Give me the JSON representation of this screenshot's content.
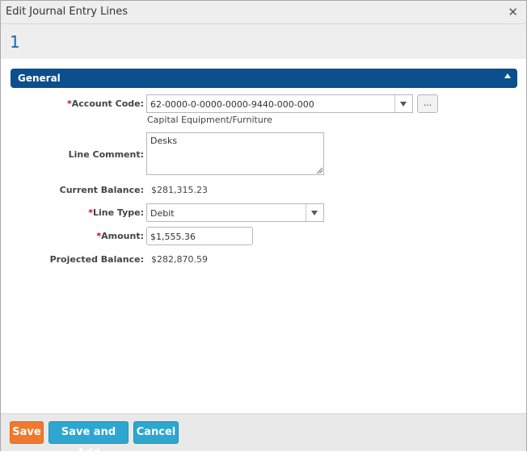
{
  "window": {
    "title": "Edit Journal Entry Lines"
  },
  "header": {
    "record_id": "1"
  },
  "section": {
    "title": "General"
  },
  "fields": {
    "required_mark": "*",
    "account_code": {
      "label": "Account Code:",
      "value": "62-0000-0-0000-0000-9440-000-000",
      "description": "Capital Equipment/Furniture",
      "lookup_label": "..."
    },
    "line_comment": {
      "label": "Line Comment:",
      "value": "Desks"
    },
    "current_balance": {
      "label": "Current Balance:",
      "value": "$281,315.23"
    },
    "line_type": {
      "label": "Line Type:",
      "value": "Debit"
    },
    "amount": {
      "label": "Amount:",
      "value": "$1,555.36"
    },
    "projected_balance": {
      "label": "Projected Balance:",
      "value": "$282,870.59"
    }
  },
  "footer": {
    "save_label": "Save",
    "save_add_label": "Save and Add",
    "cancel_label": "Cancel"
  },
  "icons": {
    "close": "close-icon",
    "collapse": "chevron-up-icon",
    "dropdown": "chevron-down-icon",
    "resize": "resize-grip-icon"
  },
  "colors": {
    "accent": "#1b64a6",
    "section_bar": "#0b4f8c",
    "required": "#d0021b",
    "save_button": "#ef7a2e",
    "secondary_button": "#2da7cf"
  }
}
